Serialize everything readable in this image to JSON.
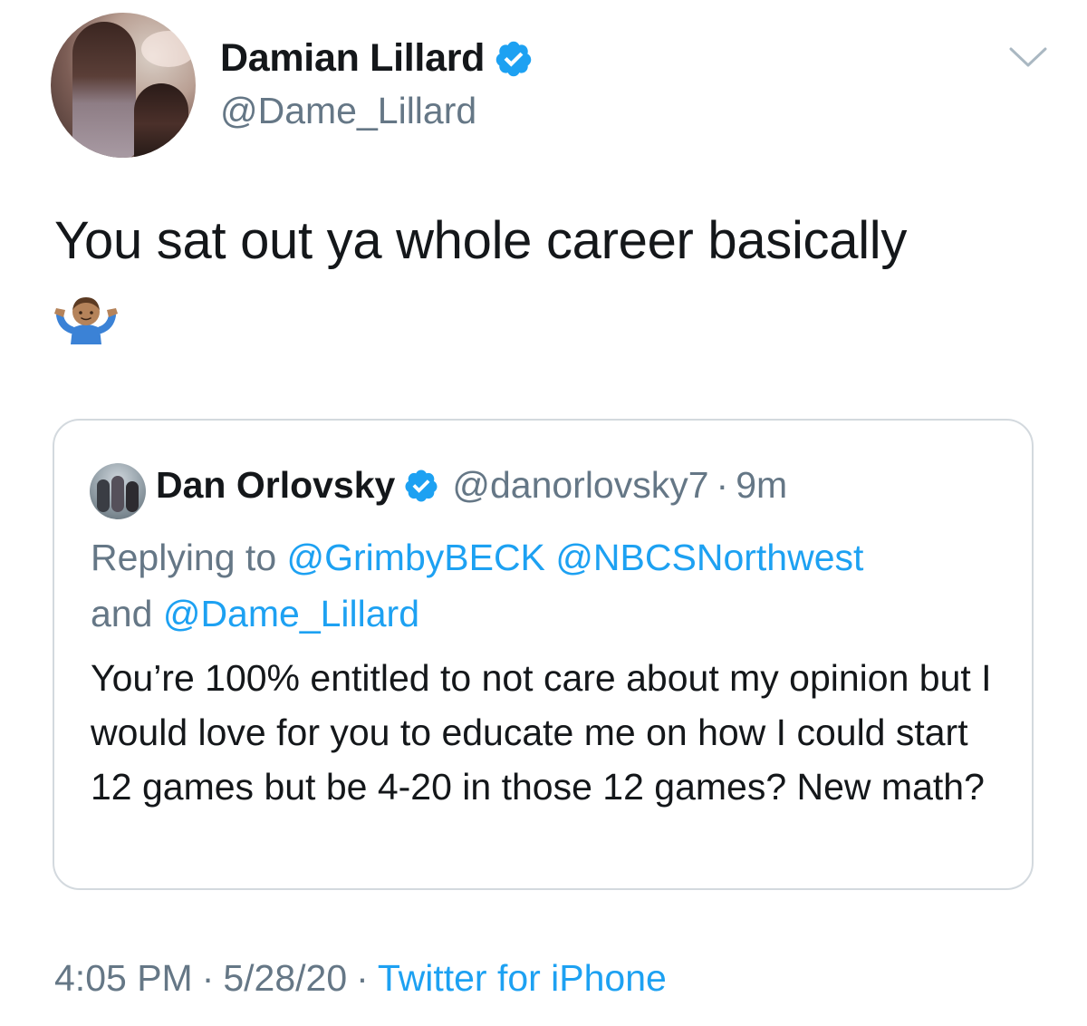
{
  "author": {
    "display_name": "Damian Lillard",
    "handle": "@Dame_Lillard",
    "verified": true
  },
  "tweet": {
    "text": "You sat out ya whole career basically",
    "emoji": "person-shrugging"
  },
  "quoted_tweet": {
    "display_name": "Dan Orlovsky",
    "handle": "@danorlovsky7",
    "separator": "·",
    "time": "9m",
    "reply_prefix": "Replying to ",
    "reply_mentions": [
      "@GrimbyBECK",
      "@NBCSNorthwest",
      "@Dame_Lillard"
    ],
    "reply_and": "and",
    "text": "You’re 100% entitled to not care about my opinion but I would love for you to educate me on how I could start 12 games but be 4-20 in those 12 games? New math?"
  },
  "footer": {
    "time": "4:05 PM",
    "date": "5/28/20",
    "separator": "·",
    "source": "Twitter for iPhone"
  },
  "icons": {
    "menu": "chevron-down-icon",
    "verified": "verified-badge-icon"
  },
  "colors": {
    "text": "#14171a",
    "secondary": "#657786",
    "link": "#1da1f2",
    "border": "#d3d9de"
  }
}
